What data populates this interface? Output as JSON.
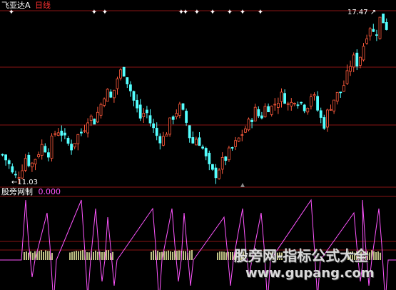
{
  "colors": {
    "background": "#000000",
    "grid": "#8a1414",
    "up": "#ff5a3c",
    "down": "#54ffff",
    "indicator_line": "#ff55ff",
    "indicator_bars": "#ffffb0",
    "markers": "#ffffff",
    "title_stock": "#ffffff",
    "title_period": "#ff3030",
    "sub_title": "#ffffff",
    "sub_value": "#ff55ff"
  },
  "main_panel": {
    "stock_name": "飞亚达A",
    "period": "日线",
    "high_label": "17.47",
    "low_label": "11.03"
  },
  "sub_panel": {
    "indicator_name": "股旁网制",
    "indicator_value": "0.000"
  },
  "watermark": {
    "title": "股旁网-指标公式大全",
    "url": "www.gupang.com"
  },
  "chart_data": [
    {
      "type": "candlestick",
      "title": "飞亚达A 日线",
      "y_range": [
        11.0,
        17.6
      ],
      "price_extremes": {
        "high": 17.47,
        "low": 11.03
      },
      "close_path_approx": [
        12.1,
        11.8,
        11.2,
        11.4,
        12.0,
        11.7,
        12.1,
        12.5,
        12.2,
        12.9,
        13.1,
        12.6,
        12.4,
        12.8,
        13.0,
        13.6,
        13.4,
        13.9,
        14.6,
        14.2,
        15.0,
        15.4,
        14.8,
        14.1,
        13.5,
        13.8,
        13.2,
        12.8,
        12.7,
        13.2,
        13.7,
        13.9,
        13.4,
        12.5,
        12.8,
        12.3,
        11.6,
        11.3,
        11.7,
        12.0,
        12.3,
        12.6,
        13.0,
        13.3,
        13.8,
        13.5,
        14.0,
        13.9,
        14.2,
        14.4,
        13.9,
        14.3,
        14.1,
        13.9,
        14.5,
        13.8,
        13.2,
        13.9,
        14.3,
        14.5,
        15.0,
        15.8,
        15.6,
        16.3,
        17.1,
        16.6,
        17.4,
        17.0
      ],
      "top_markers_count": 10
    },
    {
      "type": "line",
      "title": "股旁网制",
      "value": 0.0,
      "series": [
        {
          "name": "股旁网制",
          "color": "#ff55ff"
        }
      ],
      "baseline": 0,
      "spike_highs": [
        0.7,
        0.55,
        0.7,
        0.6,
        0.5,
        0.6,
        0.6,
        0.55,
        0.5,
        0.6,
        0.55
      ],
      "spike_lows": [
        -0.2,
        -0.5,
        -0.45,
        -0.25,
        -0.3,
        -0.5,
        -0.25,
        -0.3,
        -0.3
      ]
    }
  ]
}
